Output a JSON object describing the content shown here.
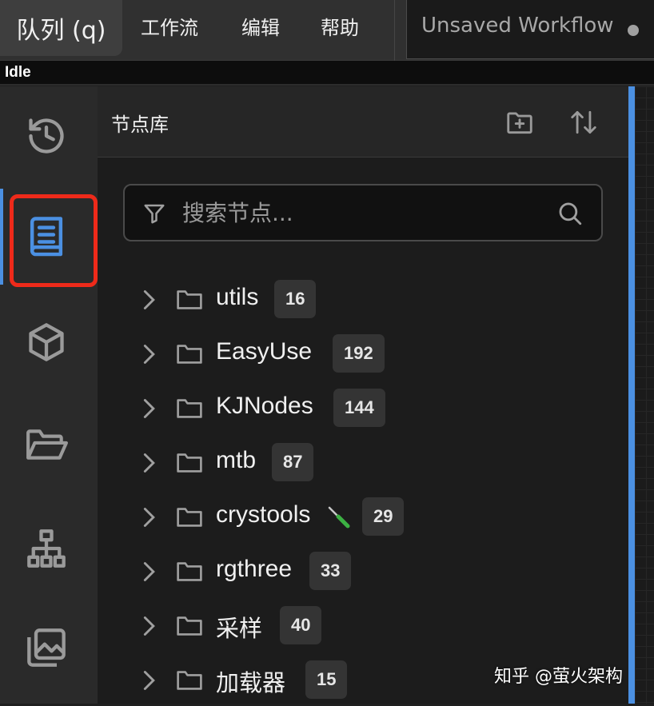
{
  "menubar": {
    "queue_label": "队列 (q)",
    "items": [
      {
        "label": "工作流"
      },
      {
        "label": "编辑"
      },
      {
        "label": "帮助"
      }
    ]
  },
  "workflow_tab": {
    "title": "Unsaved Workflow"
  },
  "status": {
    "text": "Idle"
  },
  "sidebar": {
    "icons": [
      {
        "icon": "history-icon"
      },
      {
        "icon": "node-library-icon",
        "active": true
      },
      {
        "icon": "model-library-icon"
      },
      {
        "icon": "workflows-folder-icon"
      },
      {
        "icon": "node-map-icon"
      },
      {
        "icon": "image-gallery-icon"
      }
    ]
  },
  "node_library": {
    "title": "节点库",
    "search": {
      "placeholder": "搜索节点..."
    },
    "folders": [
      {
        "name": "utils",
        "count": "16"
      },
      {
        "name": "EasyUse",
        "count": "192"
      },
      {
        "name": "KJNodes",
        "count": "144"
      },
      {
        "name": "mtb",
        "count": "87"
      },
      {
        "name": "crystools",
        "count": "29",
        "icon": "screwdriver-icon"
      },
      {
        "name": "rgthree",
        "count": "33"
      },
      {
        "name": "采样",
        "count": "40"
      },
      {
        "name": "加载器",
        "count": "15"
      }
    ]
  },
  "watermark": {
    "text": "知乎 @萤火架构"
  },
  "colors": {
    "accent": "#4b90e2",
    "highlight": "#ee2a1a"
  }
}
